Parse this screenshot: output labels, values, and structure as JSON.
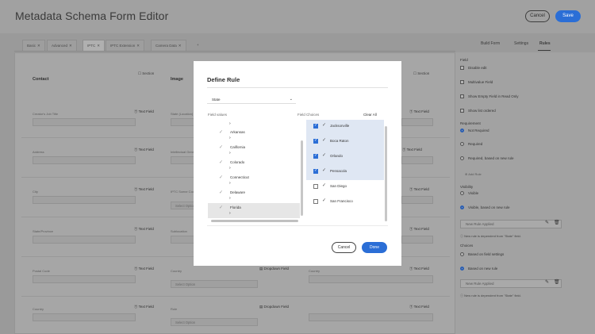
{
  "app": {
    "title": "Metadata Schema Form Editor",
    "cancel_label": "Cancel",
    "save_label": "Save"
  },
  "tabs": [
    {
      "label": "Basic",
      "close": "✕"
    },
    {
      "label": "Advanced",
      "close": "✕"
    },
    {
      "label": "IPTC",
      "close": "✕"
    },
    {
      "label": "IPTC Extension",
      "close": "✕"
    },
    {
      "label": "Camera Data",
      "close": "✕"
    },
    {
      "label": "+",
      "close": ""
    }
  ],
  "right_tabs": [
    "Build Form",
    "Settings",
    "Rules"
  ],
  "form": {
    "columns": [
      {
        "title": "Contact",
        "section": "☐ Section"
      },
      {
        "title": "Image",
        "section": ""
      },
      {
        "title": "",
        "section": "☐ Section"
      }
    ],
    "rows": [
      {
        "label": "Creator's Job Title",
        "col1_type": "Ⓣ Text Field",
        "col3_type": "Ⓣ Text Field",
        "col2_label": "State (Location)"
      },
      {
        "label": "Address",
        "col1_type": "Ⓣ Text Field",
        "col3_type": "Ⓣ Text Field",
        "col2_label": "Intellectual Genre"
      },
      {
        "label": "City",
        "col1_type": "Ⓣ Text Field",
        "col3_type": "Ⓣ Text Field",
        "col2_label": "IPTC Scene Code"
      },
      {
        "label": "State/Province",
        "col1_type": "Ⓣ Text Field",
        "col3_type": "Ⓣ Text Field",
        "col2_label": "Sublocation"
      },
      {
        "label": "Postal Code",
        "col1_type": "Ⓣ Text Field",
        "col3_type": "Ⓣ Text Field",
        "col2_label": "Country"
      },
      {
        "label": "Country",
        "col1_type": "Ⓣ Text Field",
        "col3_type": "Ⓣ Text Field",
        "col2_label": "Role"
      }
    ],
    "select_placeholder": "Select Option",
    "dropdown_field": "▤ Dropdown Field"
  },
  "panel": {
    "field_heading": "Field",
    "checkboxes": [
      "Disable edit",
      "Multivalue Field",
      "Show Empty Field in Read Only",
      "Show list ordered"
    ],
    "requirement_heading": "Requirement",
    "requirement_options": [
      "Not Required",
      "Required",
      "Required, based on new rule"
    ],
    "add_rule": "⊕ Add Rule",
    "visibility_heading": "Visibility",
    "visibility_options": [
      "Visible",
      "Visible, based on new rule"
    ],
    "rule_applied": "New Rule Applied",
    "visibility_note": "New rule is dependent from \"State\" field.",
    "choices_heading": "Choices",
    "choices_options": [
      "Based on field settings",
      "Based on new rule"
    ],
    "choices_note": "New rule is dependent from \"State\" field."
  },
  "dialog": {
    "title": "Define Rule",
    "selected_field": "State",
    "field_values_heading": "Field values",
    "field_choices_heading": "Field Choices",
    "clear_all": "Clear All",
    "values": [
      "Arkansas",
      "California",
      "Colorado",
      "Connecticut",
      "Delaware",
      "Florida"
    ],
    "choices": [
      {
        "label": "Jacksonville",
        "checked": true
      },
      {
        "label": "Boca Raton",
        "checked": true
      },
      {
        "label": "Orlando",
        "checked": true
      },
      {
        "label": "Pensacola",
        "checked": true
      },
      {
        "label": "San Diego",
        "checked": false
      },
      {
        "label": "San Francisco",
        "checked": false
      }
    ],
    "cancel_label": "Cancel",
    "done_label": "Done"
  },
  "colors": {
    "accent": "#2b6ed6",
    "overlay_bg": "#9a9a9a",
    "selected_choice_bg": "#dfe7f3"
  }
}
